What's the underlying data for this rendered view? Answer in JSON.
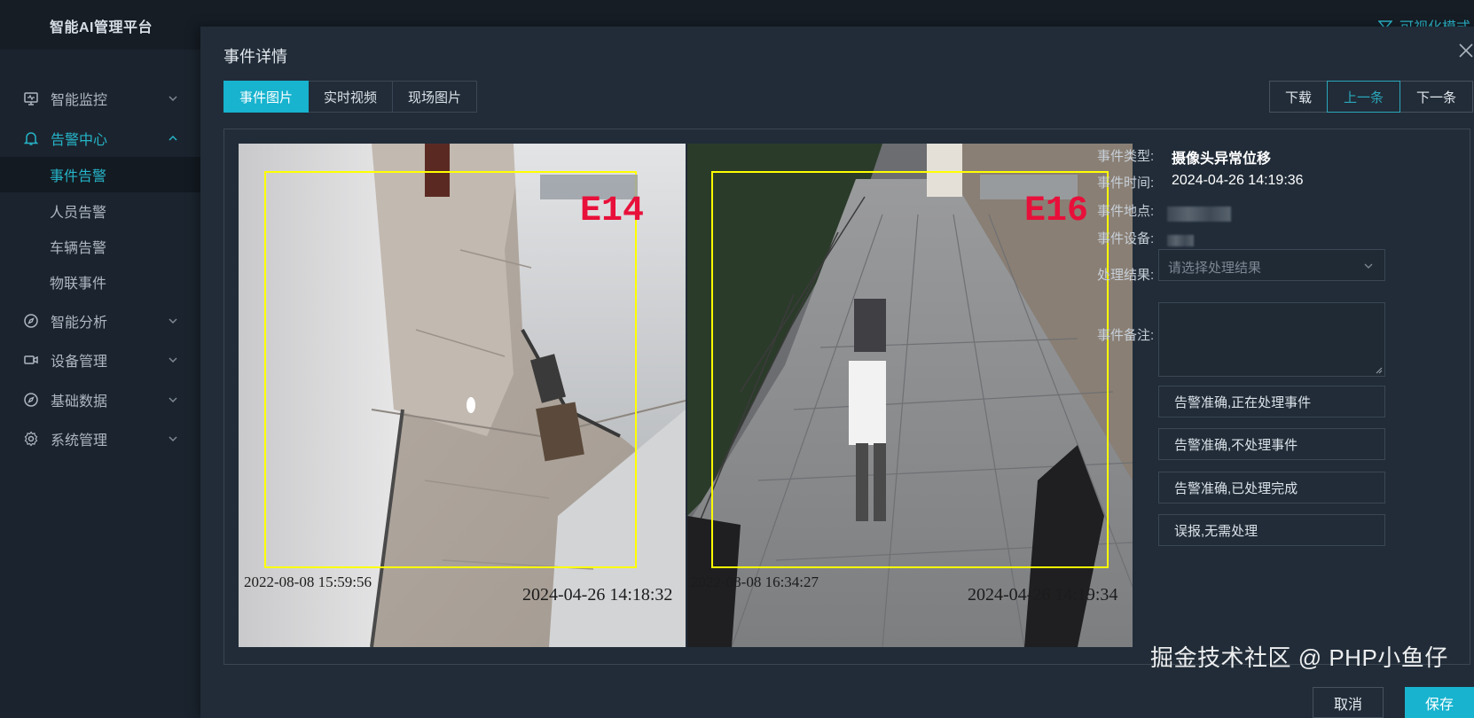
{
  "app": {
    "title": "智能AI管理平台",
    "vis_mode": "可视化模式"
  },
  "sidebar": {
    "items": [
      {
        "label": "智能监控",
        "icon": "monitor-icon"
      },
      {
        "label": "告警中心",
        "icon": "bell-icon",
        "expanded": true,
        "children": [
          {
            "label": "事件告警",
            "active": true
          },
          {
            "label": "人员告警"
          },
          {
            "label": "车辆告警"
          },
          {
            "label": "物联事件"
          }
        ]
      },
      {
        "label": "智能分析",
        "icon": "compass-icon"
      },
      {
        "label": "设备管理",
        "icon": "camera-icon"
      },
      {
        "label": "基础数据",
        "icon": "compass-icon"
      },
      {
        "label": "系统管理",
        "icon": "gear-icon"
      }
    ]
  },
  "modal": {
    "title": "事件详情",
    "tabs": [
      {
        "label": "事件图片",
        "active": true
      },
      {
        "label": "实时视频"
      },
      {
        "label": "现场图片"
      }
    ],
    "nav": {
      "download": "下载",
      "prev": "上一条",
      "next": "下一条"
    },
    "images": [
      {
        "date_left": "2022-08-08 15:59:56",
        "date_right": "2024-04-26 14:18:32",
        "channel": "E14"
      },
      {
        "date_left": "2022-08-08 16:34:27",
        "date_right": "2024-04-26 14:19:34",
        "channel": "E16"
      }
    ],
    "info": {
      "type_label": "事件类型:",
      "type_value": "摄像头异常位移",
      "time_label": "事件时间:",
      "time_value": "2024-04-26 14:19:36",
      "location_label": "事件地点:",
      "device_label": "事件设备:",
      "result_label": "处理结果:",
      "result_placeholder": "请选择处理结果",
      "note_label": "事件备注:"
    },
    "actions": [
      "告警准确,正在处理事件",
      "告警准确,不处理事件",
      "告警准确,已处理完成",
      "误报,无需处理"
    ],
    "footer": {
      "cancel": "取消",
      "save": "保存"
    }
  },
  "watermark": "掘金技术社区 @ PHP小鱼仔",
  "colors": {
    "accent": "#17b3cf",
    "box": "#ffff00",
    "channel": "#e8103a"
  }
}
